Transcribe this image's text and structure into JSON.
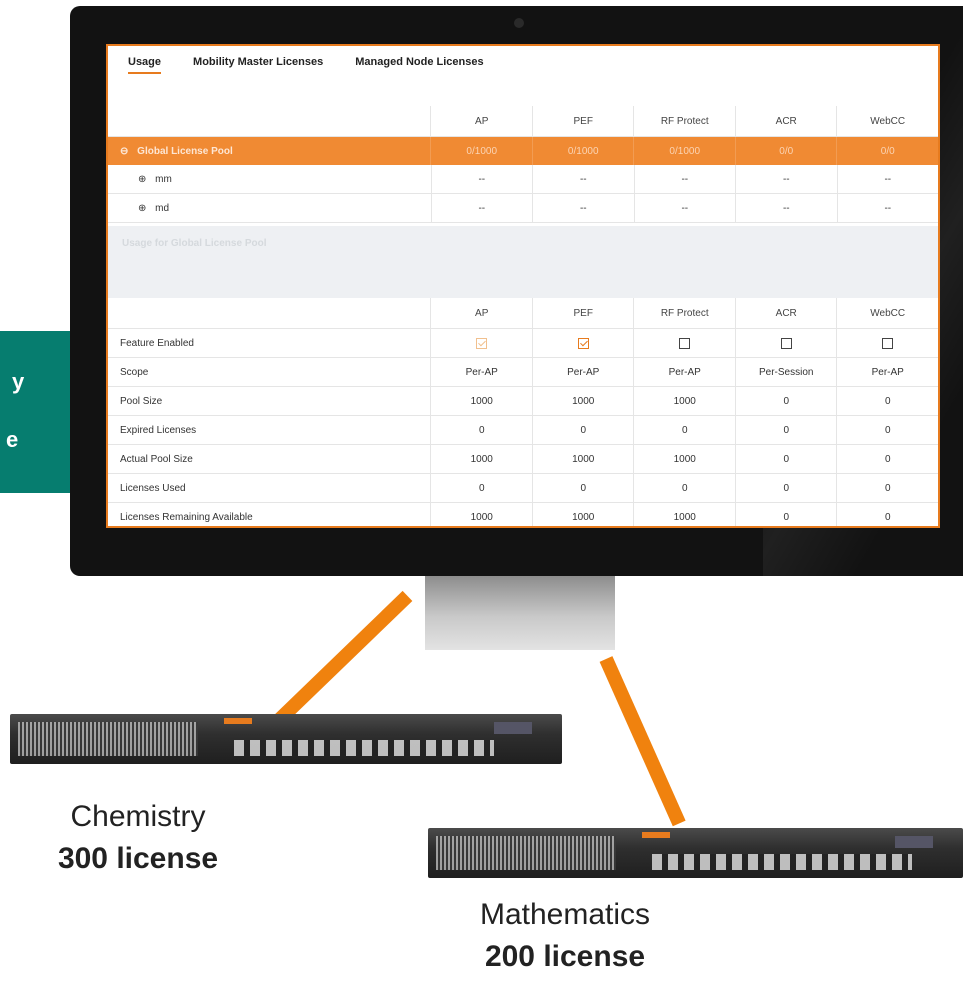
{
  "side_card": {
    "line1": "y",
    "line2": "e"
  },
  "tabs": [
    "Usage",
    "Mobility Master Licenses",
    "Managed Node Licenses"
  ],
  "license_columns": [
    "AP",
    "PEF",
    "RF Protect",
    "ACR",
    "WebCC"
  ],
  "global_pool": {
    "label": "Global License Pool",
    "values": [
      "0/1000",
      "0/1000",
      "0/1000",
      "0/0",
      "0/0"
    ],
    "children": [
      {
        "label": "mm",
        "values": [
          "--",
          "--",
          "--",
          "--",
          "--"
        ]
      },
      {
        "label": "md",
        "values": [
          "--",
          "--",
          "--",
          "--",
          "--"
        ]
      }
    ]
  },
  "usage_section_title": "Usage for Global License Pool",
  "usage_columns": [
    "AP",
    "PEF",
    "RF Protect",
    "ACR",
    "WebCC"
  ],
  "feature_enabled": {
    "label": "Feature Enabled",
    "checked": [
      true,
      true,
      false,
      false,
      false
    ]
  },
  "usage_rows": [
    {
      "label": "Scope",
      "values": [
        "Per-AP",
        "Per-AP",
        "Per-AP",
        "Per-Session",
        "Per-AP"
      ]
    },
    {
      "label": "Pool Size",
      "values": [
        "1000",
        "1000",
        "1000",
        "0",
        "0"
      ]
    },
    {
      "label": "Expired Licenses",
      "values": [
        "0",
        "0",
        "0",
        "0",
        "0"
      ]
    },
    {
      "label": "Actual Pool Size",
      "values": [
        "1000",
        "1000",
        "1000",
        "0",
        "0"
      ]
    },
    {
      "label": "Licenses Used",
      "values": [
        "0",
        "0",
        "0",
        "0",
        "0"
      ]
    },
    {
      "label": "Licenses Remaining Available",
      "values": [
        "1000",
        "1000",
        "1000",
        "0",
        "0"
      ]
    }
  ],
  "controllers": {
    "chemistry": {
      "name": "Chemistry",
      "license": "300 license"
    },
    "mathematics": {
      "name": "Mathematics",
      "license": "200 license"
    }
  },
  "colors": {
    "accent": "#e77b1e",
    "teal": "#067d6f",
    "connector": "#f0820e"
  }
}
